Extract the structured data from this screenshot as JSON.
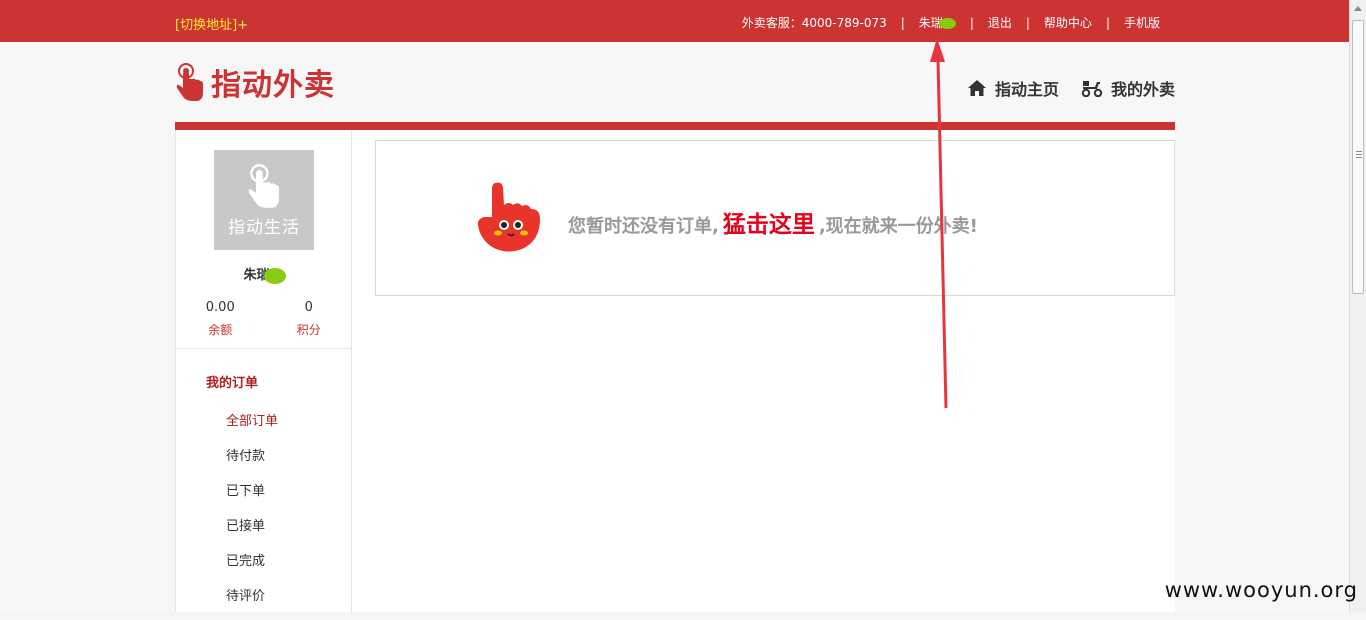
{
  "topbar": {
    "switch_address": "[切换地址]+",
    "service": "外卖客服：4000-789-073",
    "user": "朱瑞",
    "logout": "退出",
    "help": "帮助中心",
    "mobile": "手机版",
    "separator": "|"
  },
  "header": {
    "logo_text": "指动外卖",
    "nav": [
      {
        "label": "指动主页",
        "icon": "home-icon"
      },
      {
        "label": "我的外卖",
        "icon": "scooter-icon"
      }
    ]
  },
  "sidebar": {
    "avatar_text": "指动生活",
    "username": "朱瑞",
    "balance_value": "0.00",
    "balance_label": "余额",
    "points_value": "0",
    "points_label": "积分",
    "menu_title": "我的订单",
    "menu": [
      "全部订单",
      "待付款",
      "已下单",
      "已接单",
      "已完成",
      "待评价"
    ]
  },
  "notice": {
    "before": "您暂时还没有订单,",
    "link": "猛击这里",
    "after": ",现在就来一份外卖!"
  },
  "watermark": "www.wooyun.org",
  "colors": {
    "brand_red": "#cc3333",
    "link_red": "#e8001a",
    "address_yellow": "#ffee33",
    "redaction_green": "#88cc11",
    "arrow_red": "#e8343e"
  }
}
